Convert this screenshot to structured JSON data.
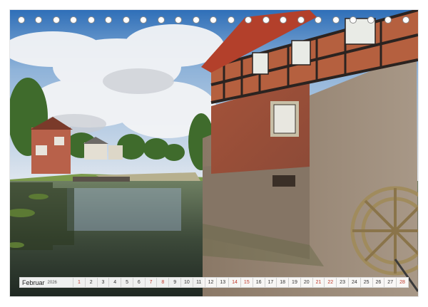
{
  "calendar": {
    "month": "Februar",
    "year": "2026",
    "days": [
      {
        "n": "1",
        "weekend": true
      },
      {
        "n": "2",
        "weekend": false
      },
      {
        "n": "3",
        "weekend": false
      },
      {
        "n": "4",
        "weekend": false
      },
      {
        "n": "5",
        "weekend": false
      },
      {
        "n": "6",
        "weekend": false
      },
      {
        "n": "7",
        "weekend": true
      },
      {
        "n": "8",
        "weekend": true
      },
      {
        "n": "9",
        "weekend": false
      },
      {
        "n": "10",
        "weekend": false
      },
      {
        "n": "11",
        "weekend": false
      },
      {
        "n": "12",
        "weekend": false
      },
      {
        "n": "13",
        "weekend": false
      },
      {
        "n": "14",
        "weekend": true
      },
      {
        "n": "15",
        "weekend": true
      },
      {
        "n": "16",
        "weekend": false
      },
      {
        "n": "17",
        "weekend": false
      },
      {
        "n": "18",
        "weekend": false
      },
      {
        "n": "19",
        "weekend": false
      },
      {
        "n": "20",
        "weekend": false
      },
      {
        "n": "21",
        "weekend": true
      },
      {
        "n": "22",
        "weekend": true
      },
      {
        "n": "23",
        "weekend": false
      },
      {
        "n": "24",
        "weekend": false
      },
      {
        "n": "25",
        "weekend": false
      },
      {
        "n": "26",
        "weekend": false
      },
      {
        "n": "27",
        "weekend": false
      },
      {
        "n": "28",
        "weekend": true
      }
    ]
  },
  "colors": {
    "weekend": "#c0392b",
    "weekday": "#333333",
    "ring": "#8a8a8a"
  }
}
